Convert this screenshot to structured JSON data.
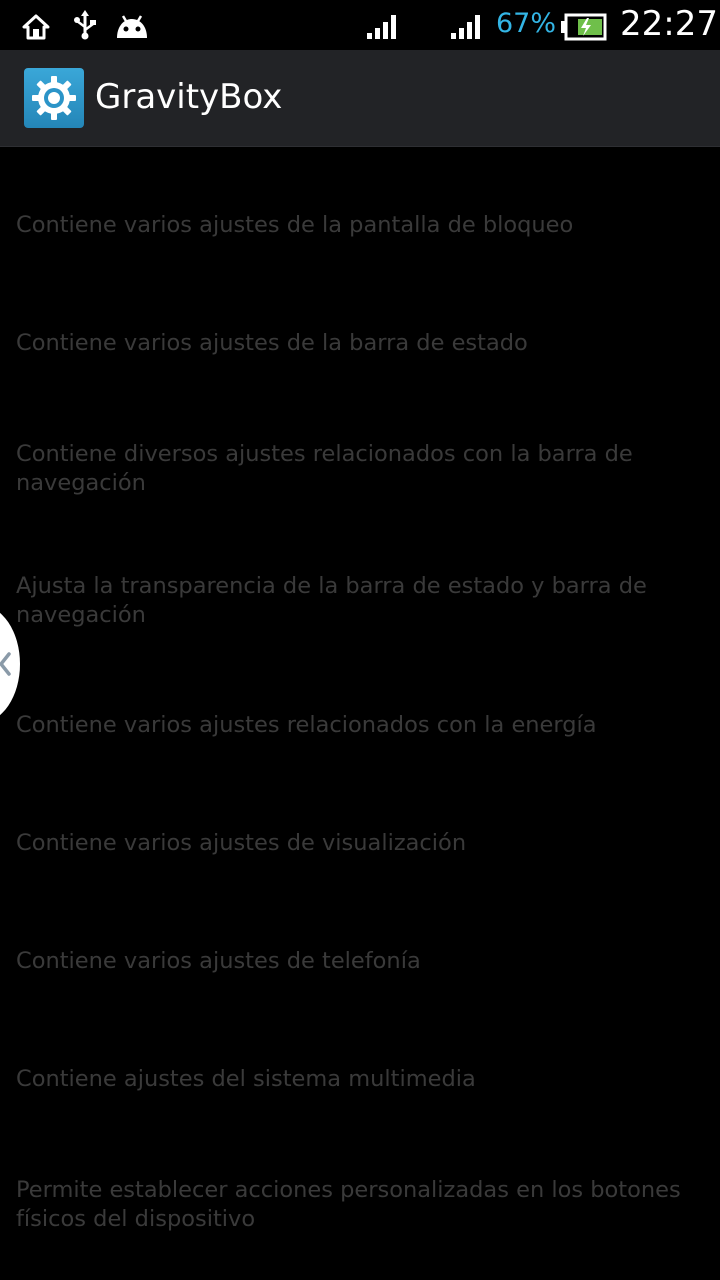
{
  "status_bar": {
    "icons_left": [
      "home-icon",
      "usb-icon",
      "android-icon"
    ],
    "icons_right": [
      "signal-icon",
      "signal-icon",
      "battery-charging-icon"
    ],
    "battery_percent": "67%",
    "time": "22:27",
    "accent_color": "#33b5e5"
  },
  "action_bar": {
    "title": "GravityBox",
    "icon": "gear-icon"
  },
  "list": {
    "items": [
      {
        "summary": "Contiene varios ajustes de la pantalla de bloqueo"
      },
      {
        "summary": "Contiene varios ajustes de la barra de estado"
      },
      {
        "summary": "Contiene diversos ajustes relacionados con la barra de navegación"
      },
      {
        "summary": "Ajusta la transparencia de la barra de estado y barra de navegación"
      },
      {
        "summary": "Contiene varios ajustes relacionados con la energía"
      },
      {
        "summary": "Contiene varios ajustes de visualización"
      },
      {
        "summary": "Contiene varios ajustes de telefonía"
      },
      {
        "summary": "Contiene ajustes del sistema multimedia"
      },
      {
        "summary": "Permite establecer acciones personalizadas en los botones físicos del dispositivo"
      }
    ]
  },
  "edge_handle": {
    "icon": "chevron-left-icon"
  }
}
